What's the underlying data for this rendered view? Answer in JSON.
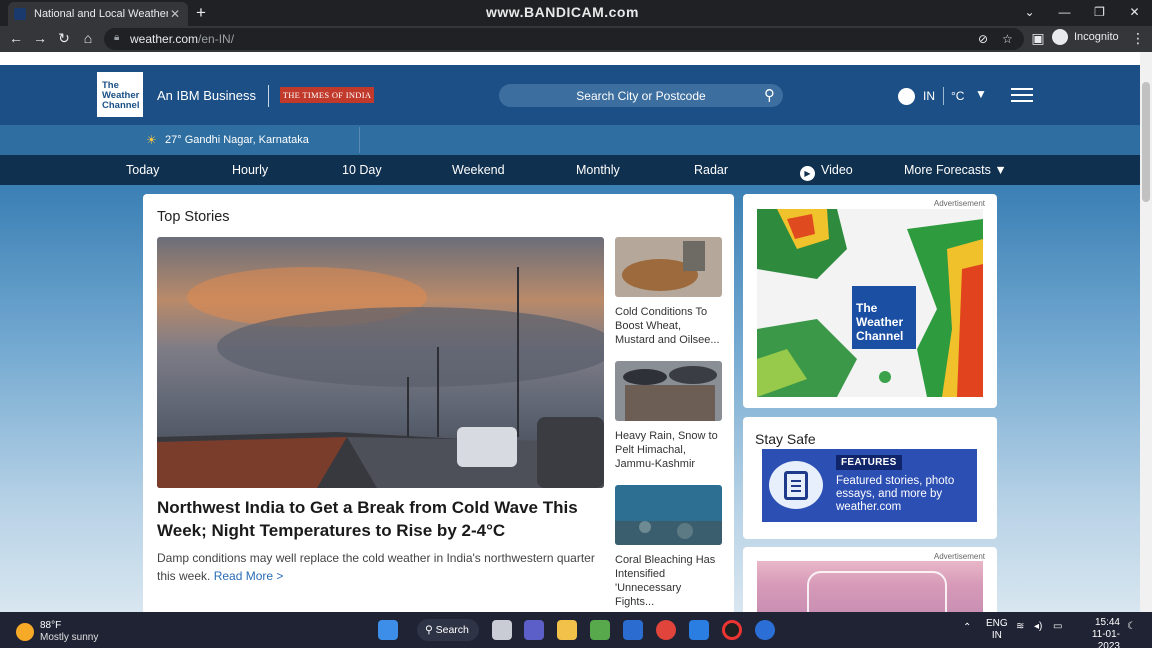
{
  "browser": {
    "tab_title": "National and Local Weather Radar",
    "tab_close": "✕",
    "new_tab": "+",
    "watermark": "www.BANDICAM.com",
    "url_host": "weather.com",
    "url_path": "/en-IN/",
    "profile_label": "Incognito",
    "window_controls": [
      "⌄",
      "—",
      "❐",
      "✕"
    ]
  },
  "header": {
    "logo_text": "The Weather Channel",
    "ibm_text": "An IBM Business",
    "partner_text": "THE TIMES OF INDIA",
    "search_placeholder": "Search City or Postcode",
    "region": "IN",
    "unit": "°C"
  },
  "location": {
    "text": "27° Gandhi Nagar, Karnataka"
  },
  "nav": {
    "items": [
      "Today",
      "Hourly",
      "10 Day",
      "Weekend",
      "Monthly",
      "Radar",
      "Video",
      "More Forecasts"
    ]
  },
  "top_stories": {
    "heading": "Top Stories",
    "main": {
      "headline": "Northwest India to Get a Break from Cold Wave This Week; Night Temperatures to Rise by 2-4°C",
      "summary": "Damp conditions may well replace the cold weather in India's northwestern quarter this week.",
      "read_more": "Read More >"
    },
    "side": [
      {
        "caption": "Cold Conditions To Boost Wheat, Mustard and Oilsee..."
      },
      {
        "caption": "Heavy Rain, Snow to Pelt Himachal, Jammu-Kashmir"
      },
      {
        "caption": "Coral Bleaching Has Intensified 'Unnecessary Fights..."
      }
    ]
  },
  "ads": {
    "label": "Advertisement",
    "brand_text": "The Weather Channel"
  },
  "stay_safe": {
    "heading": "Stay Safe",
    "tag": "FEATURES",
    "text": "Featured stories, photo essays, and more by weather.com"
  },
  "taskbar": {
    "weather_temp": "88°F",
    "weather_desc": "Mostly sunny",
    "search_label": "Search",
    "lang_line1": "ENG",
    "lang_line2": "IN",
    "time": "15:44",
    "date": "11-01-2023"
  }
}
